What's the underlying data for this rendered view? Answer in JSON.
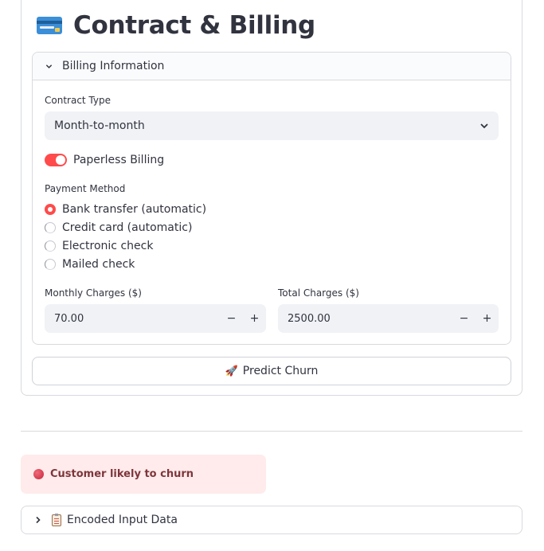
{
  "page": {
    "title": "Contract & Billing",
    "title_icon": "credit-card-icon"
  },
  "billing_expander": {
    "label": "Billing Information",
    "expanded": true
  },
  "contract_type": {
    "label": "Contract Type",
    "value": "Month-to-month"
  },
  "paperless_billing": {
    "label": "Paperless Billing",
    "checked": true
  },
  "payment_method": {
    "label": "Payment Method",
    "options": [
      "Bank transfer (automatic)",
      "Credit card (automatic)",
      "Electronic check",
      "Mailed check"
    ],
    "selected": "Bank transfer (automatic)"
  },
  "monthly_charges": {
    "label": "Monthly Charges ($)",
    "value": "70.00",
    "minus": "−",
    "plus": "+"
  },
  "total_charges": {
    "label": "Total Charges ($)",
    "value": "2500.00",
    "minus": "−",
    "plus": "+"
  },
  "predict_button": {
    "label": "Predict Churn",
    "icon": "🚀"
  },
  "result_alert": {
    "text": "Customer likely to churn",
    "icon": "red-circle-icon"
  },
  "encoded_expander": {
    "label": "Encoded Input Data",
    "icon": "clipboard-icon",
    "expanded": false
  },
  "colors": {
    "accent": "#ff4b4b",
    "alert_bg": "#ffebeb",
    "alert_text": "#7d353b",
    "input_bg": "#f0f2f6"
  }
}
